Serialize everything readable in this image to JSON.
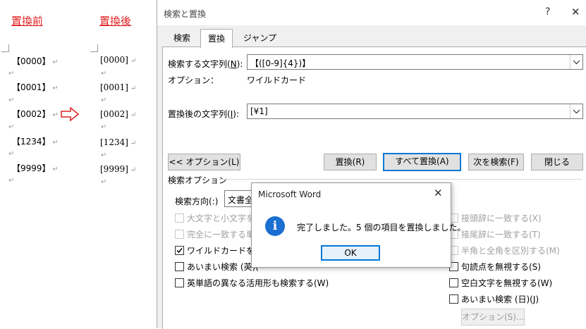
{
  "document": {
    "before_heading": "置換前",
    "after_heading": "置換後",
    "before_lines": [
      "【0000】",
      "【0001】",
      "【0002】",
      "【1234】",
      "【9999】"
    ],
    "after_lines": [
      "[0000]",
      "[0001]",
      "[0002]",
      "[1234]",
      "[9999]"
    ],
    "paragraph_mark": "↵",
    "arrow_color": "#e02020"
  },
  "dialog": {
    "title": "検索と置換",
    "help_glyph": "?",
    "close_glyph": "✕",
    "tabs": [
      {
        "label": "検索",
        "active": false
      },
      {
        "label": "置換",
        "active": true
      },
      {
        "label": "ジャンプ",
        "active": false
      }
    ],
    "find_label": "検索する文字列(",
    "find_key": "N",
    "find_suffix": "):",
    "find_value": "【([0-9]{4})】",
    "options_label": "オプション：",
    "options_value": "ワイルドカード",
    "replace_label": "置換後の文字列(",
    "replace_key": "I",
    "replace_suffix": "):",
    "replace_value": "[¥1]",
    "buttons": {
      "less_options": "<< オプション(L)",
      "replace": "置換(R)",
      "replace_all": "すべて置換(A)",
      "find_next": "次を検索(F)",
      "close": "閉じる"
    },
    "search_options_title": "検索オプション",
    "search_direction_label": "検索方向(:)",
    "search_direction_value": "文書全",
    "left_options": [
      {
        "label": "大文字と小文字を区",
        "checked": false,
        "disabled": true
      },
      {
        "label": "完全に一致する単語",
        "checked": false,
        "disabled": true
      },
      {
        "label": "ワイルドカードを使用",
        "checked": true,
        "disabled": false
      },
      {
        "label": "あいまい検索 (英)(",
        "checked": false,
        "disabled": false
      },
      {
        "label": "英単語の異なる活用形も検索する(W)",
        "checked": false,
        "disabled": false
      }
    ],
    "right_options": [
      {
        "label": "接頭辞に一致する(X)",
        "checked": false,
        "disabled": true
      },
      {
        "label": "接尾辞に一致する(T)",
        "checked": false,
        "disabled": true
      },
      {
        "label": "半角と全角を区別する(M)",
        "checked": false,
        "disabled": true
      },
      {
        "label": "句読点を無視する(S)",
        "checked": false,
        "disabled": false
      },
      {
        "label": "空白文字を無視する(W)",
        "checked": false,
        "disabled": false
      },
      {
        "label": "あいまい検索 (日)(J)",
        "checked": false,
        "disabled": false
      }
    ],
    "options_button": "オプション(S)..."
  },
  "message_box": {
    "title": "Microsoft Word",
    "close_glyph": "✕",
    "icon": "info-icon",
    "text": "完了しました。5 個の項目を置換しました。",
    "ok_label": "OK"
  }
}
